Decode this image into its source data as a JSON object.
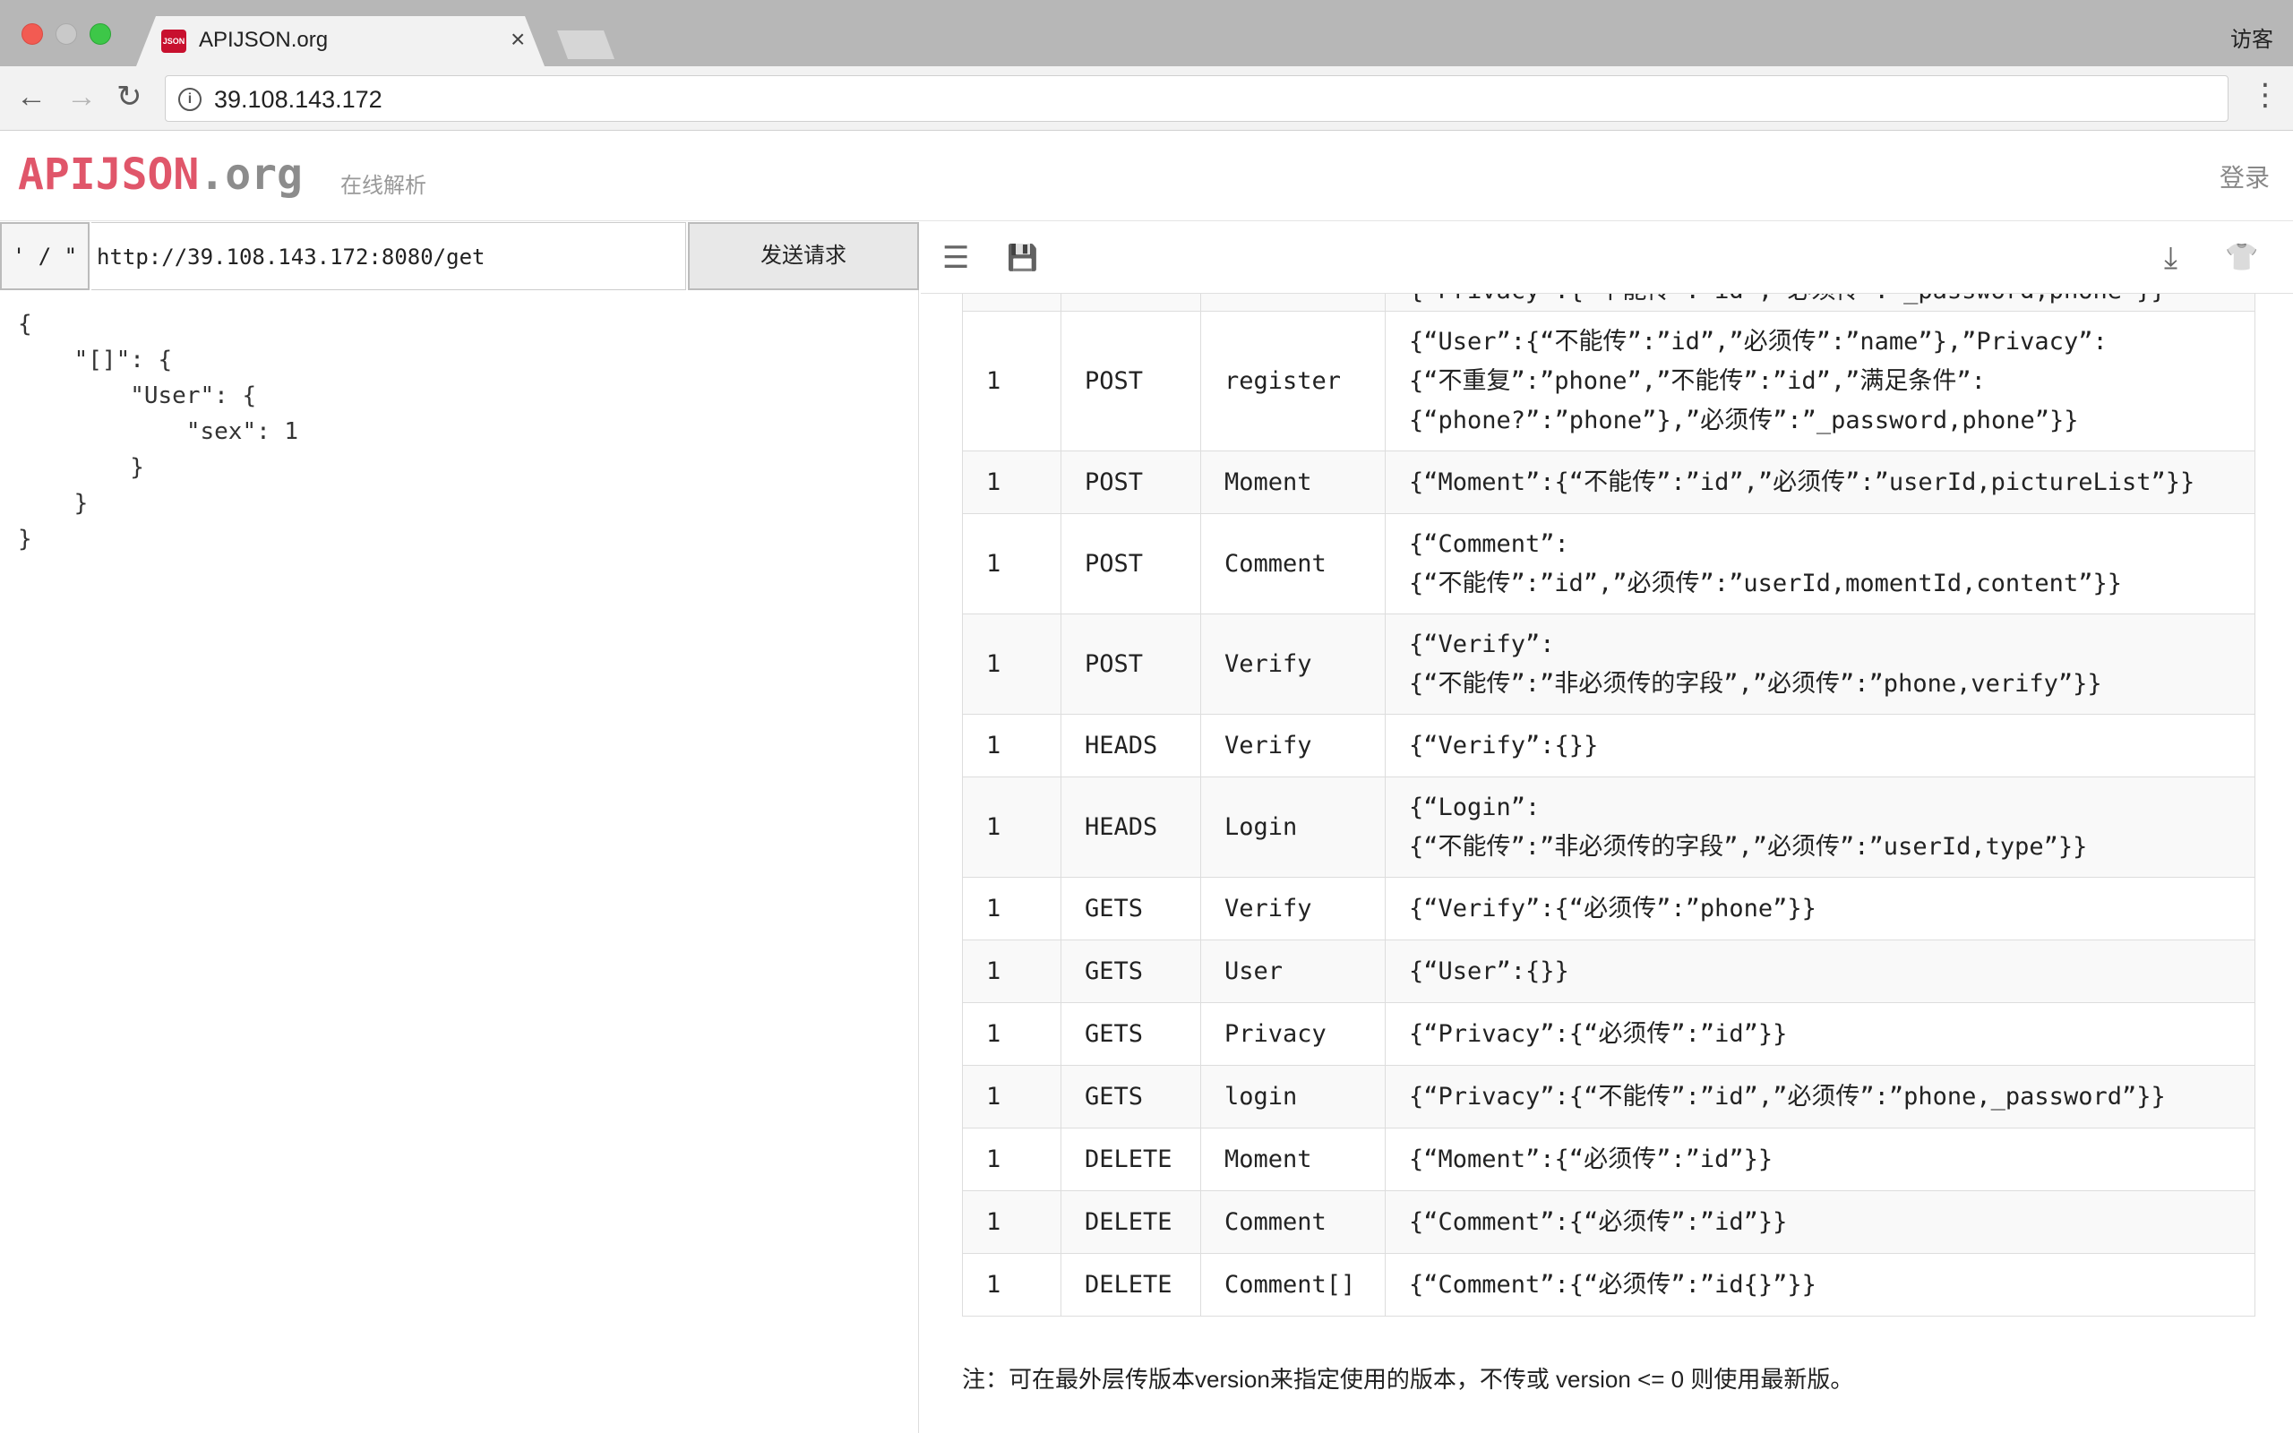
{
  "browser": {
    "tab_title": "APIJSON.org",
    "tab_close": "×",
    "favicon_text": "JSON",
    "guest_label": "访客",
    "address": "39.108.143.172",
    "info_glyph": "i",
    "back_glyph": "←",
    "forward_glyph": "→",
    "reload_glyph": "↻",
    "menu_glyph": "⋮"
  },
  "header": {
    "logo_brand": "APIJSON",
    "logo_tld": ".org",
    "subtitle": "在线解析",
    "login": "登录"
  },
  "request": {
    "quote_label": "' / \"",
    "url": "http://39.108.143.172:8080/get",
    "send_label": "发送请求",
    "body": "{\n    \"[]\": {\n        \"User\": {\n            \"sex\": 1\n        }\n    }\n}"
  },
  "icons": {
    "list": "☰",
    "save": "💾",
    "download": "⤓",
    "shirt": "👕"
  },
  "table": {
    "partial_row": [
      "",
      "",
      "",
      "{“Privacy”:{“不能传”:”id”,”必须传”:”_password,phone”}}"
    ],
    "rows": [
      {
        "version": "1",
        "method": "POST",
        "tag": "register",
        "structure": "{“User”:{“不能传”:”id”,”必须传”:”name”},”Privacy”:\n{“不重复”:”phone”,”不能传”:”id”,”满足条件”:\n{“phone?”:”phone”},”必须传”:”_password,phone”}}"
      },
      {
        "version": "1",
        "method": "POST",
        "tag": "Moment",
        "structure": "{“Moment”:{“不能传”:”id”,”必须传”:”userId,pictureList”}}"
      },
      {
        "version": "1",
        "method": "POST",
        "tag": "Comment",
        "structure": "{“Comment”:\n{“不能传”:”id”,”必须传”:”userId,momentId,content”}}"
      },
      {
        "version": "1",
        "method": "POST",
        "tag": "Verify",
        "structure": "{“Verify”:\n{“不能传”:”非必须传的字段”,”必须传”:”phone,verify”}}"
      },
      {
        "version": "1",
        "method": "HEADS",
        "tag": "Verify",
        "structure": "{“Verify”:{}}"
      },
      {
        "version": "1",
        "method": "HEADS",
        "tag": "Login",
        "structure": "{“Login”:\n{“不能传”:”非必须传的字段”,”必须传”:”userId,type”}}"
      },
      {
        "version": "1",
        "method": "GETS",
        "tag": "Verify",
        "structure": "{“Verify”:{“必须传”:”phone”}}"
      },
      {
        "version": "1",
        "method": "GETS",
        "tag": "User",
        "structure": "{“User”:{}}"
      },
      {
        "version": "1",
        "method": "GETS",
        "tag": "Privacy",
        "structure": "{“Privacy”:{“必须传”:”id”}}"
      },
      {
        "version": "1",
        "method": "GETS",
        "tag": "login",
        "structure": "{“Privacy”:{“不能传”:”id”,”必须传”:”phone,_password”}}"
      },
      {
        "version": "1",
        "method": "DELETE",
        "tag": "Moment",
        "structure": "{“Moment”:{“必须传”:”id”}}"
      },
      {
        "version": "1",
        "method": "DELETE",
        "tag": "Comment",
        "structure": "{“Comment”:{“必须传”:”id”}}"
      },
      {
        "version": "1",
        "method": "DELETE",
        "tag": "Comment[]",
        "structure": "{“Comment”:{“必须传”:”id{}”}}"
      }
    ]
  },
  "note": "注：可在最外层传版本version来指定使用的版本，不传或 version <= 0 则使用最新版。"
}
